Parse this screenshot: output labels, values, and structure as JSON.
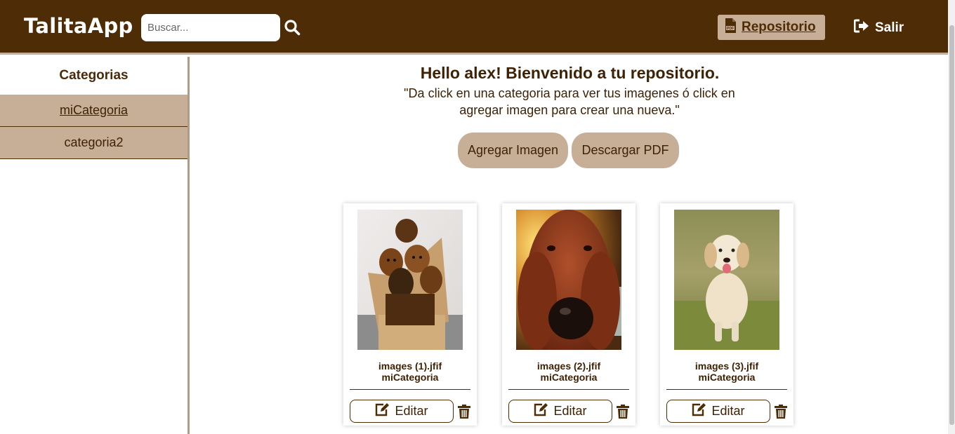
{
  "header": {
    "brand": "TalitaApp",
    "search_placeholder": "Buscar...",
    "repo_label": "Repositorio",
    "logout_label": "Salir"
  },
  "sidebar": {
    "title": "Categorias",
    "items": [
      {
        "label": "miCategoria",
        "active": true
      },
      {
        "label": "categoria2",
        "active": false
      }
    ]
  },
  "main": {
    "greeting": "Hello alex! Bienvenido a tu repositorio.",
    "subtitle": "\"Da click en una categoria para ver tus imagenes ó click en agregar imagen para crear una nueva.\"",
    "add_image_label": "Agregar Imagen",
    "download_pdf_label": "Descargar PDF"
  },
  "cards": [
    {
      "filename": "images (1).jfif",
      "category": "miCategoria",
      "edit_label": "Editar",
      "image": "puppies-in-box"
    },
    {
      "filename": "images (2).jfif",
      "category": "miCategoria",
      "edit_label": "Editar",
      "image": "setter-dog-closeup"
    },
    {
      "filename": "images (3).jfif",
      "category": "miCategoria",
      "edit_label": "Editar",
      "image": "golden-puppy-running"
    }
  ],
  "colors": {
    "header_bg": "#4e2c06",
    "accent": "#c7ae96",
    "text": "#3e2206"
  }
}
